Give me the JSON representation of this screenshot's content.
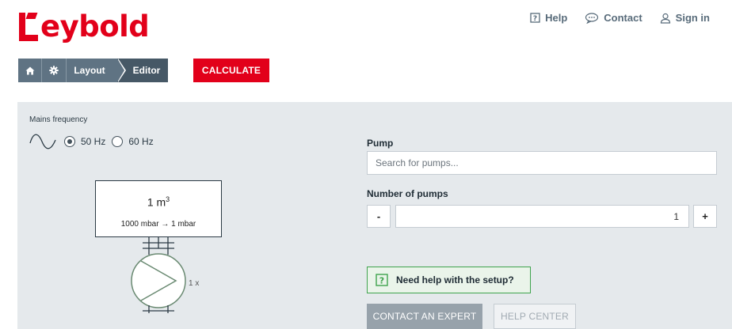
{
  "brand": {
    "name": "eybold",
    "color": "#e2001a"
  },
  "top_nav": {
    "help": "Help",
    "contact": "Contact",
    "sign_in": "Sign in"
  },
  "breadcrumb": {
    "home_icon": "home-icon",
    "settings_icon": "gear-icon",
    "layout": "Layout",
    "editor": "Editor"
  },
  "calculate_button": "CALCULATE",
  "mains": {
    "label": "Mains frequency",
    "options": [
      {
        "label": "50 Hz",
        "selected": true
      },
      {
        "label": "60 Hz",
        "selected": false
      }
    ]
  },
  "chamber": {
    "volume": "1 m",
    "volume_unit_sup": "3",
    "pressure": "1000 mbar → 1 mbar"
  },
  "pump_count_label": "1 x",
  "pump": {
    "label": "Pump",
    "placeholder": "Search for pumps..."
  },
  "number_of_pumps": {
    "label": "Number of pumps",
    "value": "1",
    "minus": "-",
    "plus": "+"
  },
  "help_box": {
    "text": "Need help with the setup?",
    "accent": "#3fa34d"
  },
  "contact_expert_button": "CONTACT AN EXPERT",
  "help_center_button": "HELP CENTER"
}
